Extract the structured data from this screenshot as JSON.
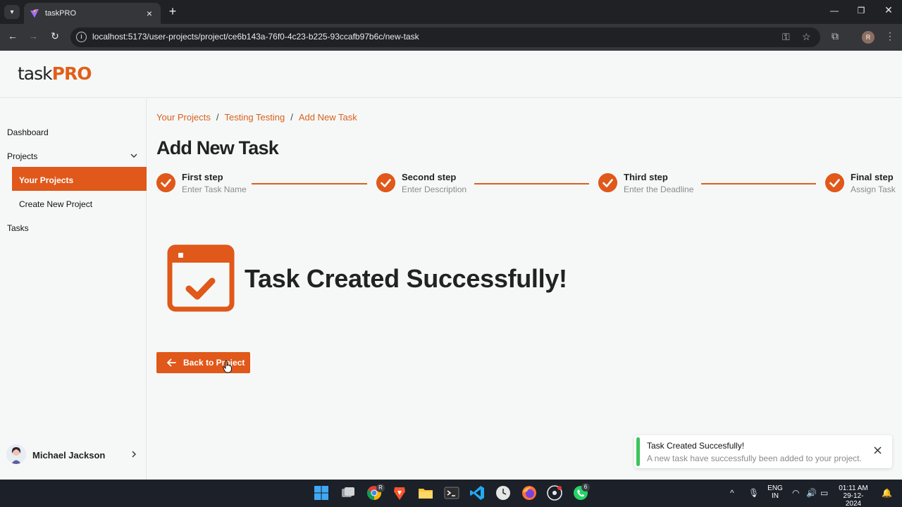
{
  "browser": {
    "tab_title": "taskPRO",
    "url": "localhost:5173/user-projects/project/ce6b143a-76f0-4c23-b225-93ccafb97b6c/new-task",
    "profile_initial": "R"
  },
  "app": {
    "logo_part1": "task",
    "logo_part2": "PRO"
  },
  "sidebar": {
    "dashboard": "Dashboard",
    "projects": "Projects",
    "your_projects": "Your Projects",
    "create_project": "Create New Project",
    "tasks": "Tasks",
    "user_name": "Michael Jackson"
  },
  "breadcrumb": {
    "items": [
      "Your Projects",
      "Testing Testing",
      "Add New Task"
    ],
    "separator": "/"
  },
  "page": {
    "title": "Add New Task",
    "steps": [
      {
        "title": "First step",
        "desc": "Enter Task Name"
      },
      {
        "title": "Second step",
        "desc": "Enter Description"
      },
      {
        "title": "Third step",
        "desc": "Enter the Deadline"
      },
      {
        "title": "Final step",
        "desc": "Assign Task"
      }
    ],
    "success_message": "Task Created Successfully!",
    "back_button": "Back to Project"
  },
  "toast": {
    "title": "Task Created Succesfully!",
    "description": "A new task have successfully been added to your project."
  },
  "taskbar": {
    "lang": "ENG",
    "region": "IN",
    "time": "01:11 AM",
    "date": "29-12-2024",
    "chrome_badge": "R",
    "whatsapp_badge": "6"
  },
  "colors": {
    "accent": "#e0581a",
    "success": "#3dc35b"
  },
  "icons": [
    "chevron-down-icon",
    "close-icon",
    "plus-icon",
    "back-icon",
    "forward-icon",
    "reload-icon",
    "info-icon",
    "key-icon",
    "star-icon",
    "extensions-icon",
    "more-icon",
    "check-icon",
    "calendar-check-icon",
    "arrow-left-icon",
    "chevron-right-icon"
  ]
}
